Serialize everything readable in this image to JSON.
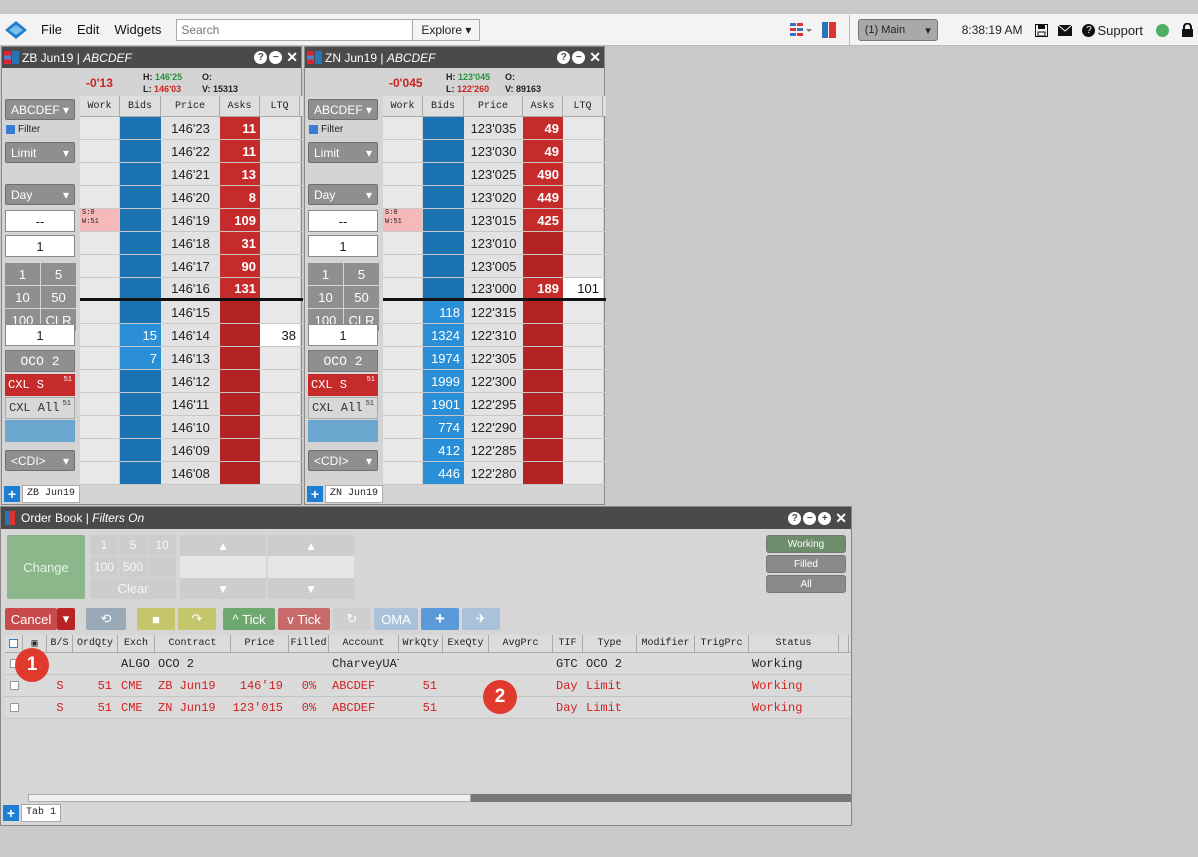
{
  "topbar": {
    "menu": [
      "File",
      "Edit",
      "Widgets"
    ],
    "search_placeholder": "Search",
    "explore_label": "Explore",
    "workspace": "(1) Main",
    "clock": "8:38:19 AM",
    "support_label": "Support"
  },
  "ladders": [
    {
      "title": "ZB Jun19",
      "account": "ABCDEF",
      "change": "-0'13",
      "high": "146'25",
      "low": "146'03",
      "open_label": "O:",
      "volume": "15313",
      "side": {
        "account_select": "ABCDEF",
        "filter_label": "Filter",
        "order_type": "Limit",
        "tif": "Day",
        "price_box": "--",
        "qty_box": "1",
        "qty_buttons": [
          "1",
          "5",
          "10",
          "50",
          "100",
          "CLR"
        ],
        "oco_qty": "1",
        "oco_label": "OCO 2",
        "cxl_s": "CXL S",
        "cxl_all": "CXL All",
        "cxl_count": "51",
        "cdi": "<CDI>"
      },
      "columns": [
        "Work",
        "Bids",
        "Price",
        "Asks",
        "LTQ"
      ],
      "rows": [
        {
          "work": "",
          "bid": "",
          "price": "146'23",
          "ask": "11",
          "ltq": ""
        },
        {
          "work": "",
          "bid": "",
          "price": "146'22",
          "ask": "11",
          "ltq": ""
        },
        {
          "work": "",
          "bid": "",
          "price": "146'21",
          "ask": "13",
          "ltq": ""
        },
        {
          "work": "",
          "bid": "",
          "price": "146'20",
          "ask": "8",
          "ltq": ""
        },
        {
          "work": "S:0 W:51",
          "bid": "",
          "price": "146'19",
          "ask": "109",
          "ltq": ""
        },
        {
          "work": "",
          "bid": "",
          "price": "146'18",
          "ask": "31",
          "ltq": ""
        },
        {
          "work": "",
          "bid": "",
          "price": "146'17",
          "ask": "90",
          "ltq": ""
        },
        {
          "work": "",
          "bid": "",
          "price": "146'16",
          "ask": "131",
          "ltq": ""
        },
        {
          "work": "",
          "bid": "",
          "price": "146'15",
          "ask": "",
          "ltq": ""
        },
        {
          "work": "",
          "bid": "15",
          "price": "146'14",
          "ask": "",
          "ltq": "38"
        },
        {
          "work": "",
          "bid": "7",
          "price": "146'13",
          "ask": "",
          "ltq": ""
        },
        {
          "work": "",
          "bid": "",
          "price": "146'12",
          "ask": "",
          "ltq": ""
        },
        {
          "work": "",
          "bid": "",
          "price": "146'11",
          "ask": "",
          "ltq": ""
        },
        {
          "work": "",
          "bid": "",
          "price": "146'10",
          "ask": "",
          "ltq": ""
        },
        {
          "work": "",
          "bid": "",
          "price": "146'09",
          "ask": "",
          "ltq": ""
        },
        {
          "work": "",
          "bid": "",
          "price": "146'08",
          "ask": "",
          "ltq": ""
        }
      ],
      "tab": "ZB Jun19"
    },
    {
      "title": "ZN Jun19",
      "account": "ABCDEF",
      "change": "-0'045",
      "high": "123'045",
      "low": "122'260",
      "open_label": "O:",
      "volume": "89163",
      "side": {
        "account_select": "ABCDEF",
        "filter_label": "Filter",
        "order_type": "Limit",
        "tif": "Day",
        "price_box": "--",
        "qty_box": "1",
        "qty_buttons": [
          "1",
          "5",
          "10",
          "50",
          "100",
          "CLR"
        ],
        "oco_qty": "1",
        "oco_label": "OCO 2",
        "cxl_s": "CXL S",
        "cxl_all": "CXL All",
        "cxl_count": "51",
        "cdi": "<CDI>"
      },
      "columns": [
        "Work",
        "Bids",
        "Price",
        "Asks",
        "LTQ"
      ],
      "rows": [
        {
          "work": "",
          "bid": "",
          "price": "123'035",
          "ask": "49",
          "ltq": ""
        },
        {
          "work": "",
          "bid": "",
          "price": "123'030",
          "ask": "49",
          "ltq": ""
        },
        {
          "work": "",
          "bid": "",
          "price": "123'025",
          "ask": "490",
          "ltq": ""
        },
        {
          "work": "",
          "bid": "",
          "price": "123'020",
          "ask": "449",
          "ltq": ""
        },
        {
          "work": "S:0 W:51",
          "bid": "",
          "price": "123'015",
          "ask": "425",
          "ltq": ""
        },
        {
          "work": "",
          "bid": "",
          "price": "123'010",
          "ask": "",
          "ltq": ""
        },
        {
          "work": "",
          "bid": "",
          "price": "123'005",
          "ask": "",
          "ltq": ""
        },
        {
          "work": "",
          "bid": "",
          "price": "123'000",
          "ask": "189",
          "ltq": "101"
        },
        {
          "work": "",
          "bid": "118",
          "price": "122'315",
          "ask": "",
          "ltq": ""
        },
        {
          "work": "",
          "bid": "1324",
          "price": "122'310",
          "ask": "",
          "ltq": ""
        },
        {
          "work": "",
          "bid": "1974",
          "price": "122'305",
          "ask": "",
          "ltq": ""
        },
        {
          "work": "",
          "bid": "1999",
          "price": "122'300",
          "ask": "",
          "ltq": ""
        },
        {
          "work": "",
          "bid": "1901",
          "price": "122'295",
          "ask": "",
          "ltq": ""
        },
        {
          "work": "",
          "bid": "774",
          "price": "122'290",
          "ask": "",
          "ltq": ""
        },
        {
          "work": "",
          "bid": "412",
          "price": "122'285",
          "ask": "",
          "ltq": ""
        },
        {
          "work": "",
          "bid": "446",
          "price": "122'280",
          "ask": "",
          "ltq": ""
        }
      ],
      "tab": "ZN Jun19"
    }
  ],
  "orderbook": {
    "title": "Order Book",
    "subtitle": "Filters On",
    "change_label": "Change",
    "pad": [
      "1",
      "5",
      "10",
      "100",
      "500",
      "Clear"
    ],
    "filters": [
      "Working",
      "Filled",
      "All"
    ],
    "toolbar": {
      "cancel": "Cancel",
      "tick_up": "Tick",
      "tick_down": "Tick",
      "oma": "OMA"
    },
    "columns": [
      "B/S",
      "OrdQty",
      "Exch",
      "Contract",
      "Price",
      "Filled",
      "Account",
      "WrkQty",
      "ExeQty",
      "AvgPrc",
      "TIF",
      "Type",
      "Modifier",
      "TrigPrc",
      "Status"
    ],
    "rows": [
      {
        "bs": "",
        "ordqty": "",
        "exch": "ALGO",
        "contract": "OCO 2",
        "price": "",
        "filled": "",
        "account": "CharveyUAT",
        "wrkqty": "",
        "exeqty": "",
        "avgprc": "",
        "tif": "GTC",
        "type": "OCO 2",
        "modifier": "",
        "trigprc": "",
        "status": "Working",
        "red": false
      },
      {
        "bs": "S",
        "ordqty": "51",
        "exch": "CME",
        "contract": "ZB Jun19",
        "price": "146'19",
        "filled": "0%",
        "account": "ABCDEF",
        "wrkqty": "51",
        "exeqty": "",
        "avgprc": "",
        "tif": "Day",
        "type": "Limit",
        "modifier": "",
        "trigprc": "",
        "status": "Working",
        "red": true
      },
      {
        "bs": "S",
        "ordqty": "51",
        "exch": "CME",
        "contract": "ZN Jun19",
        "price": "123'015",
        "filled": "0%",
        "account": "ABCDEF",
        "wrkqty": "51",
        "exeqty": "",
        "avgprc": "",
        "tif": "Day",
        "type": "Limit",
        "modifier": "",
        "trigprc": "",
        "status": "Working",
        "red": true
      }
    ],
    "tab": "Tab 1"
  },
  "badges": [
    "1",
    "2"
  ],
  "colors": {
    "bid": "#1a72b0",
    "ask": "#c62b2b",
    "accent": "#1c7fd3",
    "badge": "#e03a2e"
  }
}
